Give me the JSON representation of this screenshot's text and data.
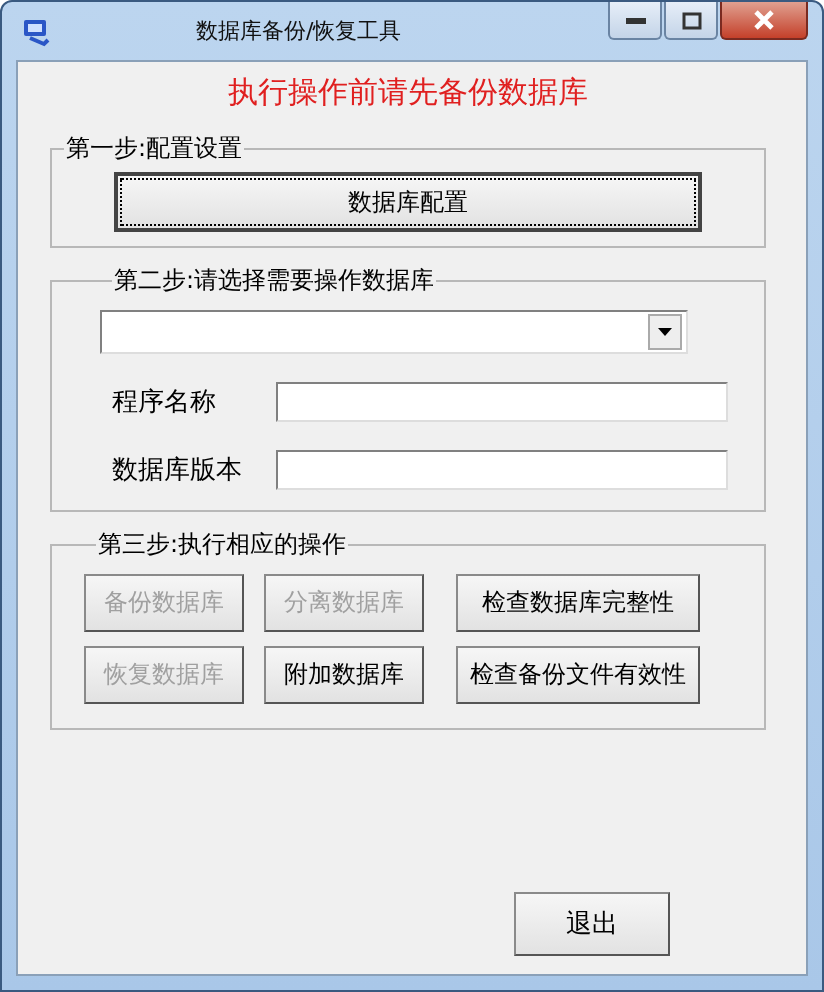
{
  "window": {
    "title": "数据库备份/恢复工具"
  },
  "warning": "执行操作前请先备份数据库",
  "step1": {
    "legend": "第一步:配置设置",
    "button": {
      "label": "数据库配置",
      "focused": true
    }
  },
  "step2": {
    "legend": "第二步:请选择需要操作数据库",
    "dropdown": {
      "expanded": false
    },
    "fields": [
      {
        "label": "程序名称"
      },
      {
        "label": "数据库版本"
      }
    ]
  },
  "step3": {
    "legend": "第三步:执行相应的操作",
    "buttons": [
      {
        "label": "备份数据库",
        "disabled": true
      },
      {
        "label": "分离数据库",
        "disabled": true
      },
      {
        "label": "检查数据库完整性",
        "disabled": false
      },
      {
        "label": "恢复数据库",
        "disabled": true
      },
      {
        "label": "附加数据库",
        "disabled": false
      },
      {
        "label": "检查备份文件有效性",
        "disabled": false
      }
    ]
  },
  "exit_button": "退出"
}
